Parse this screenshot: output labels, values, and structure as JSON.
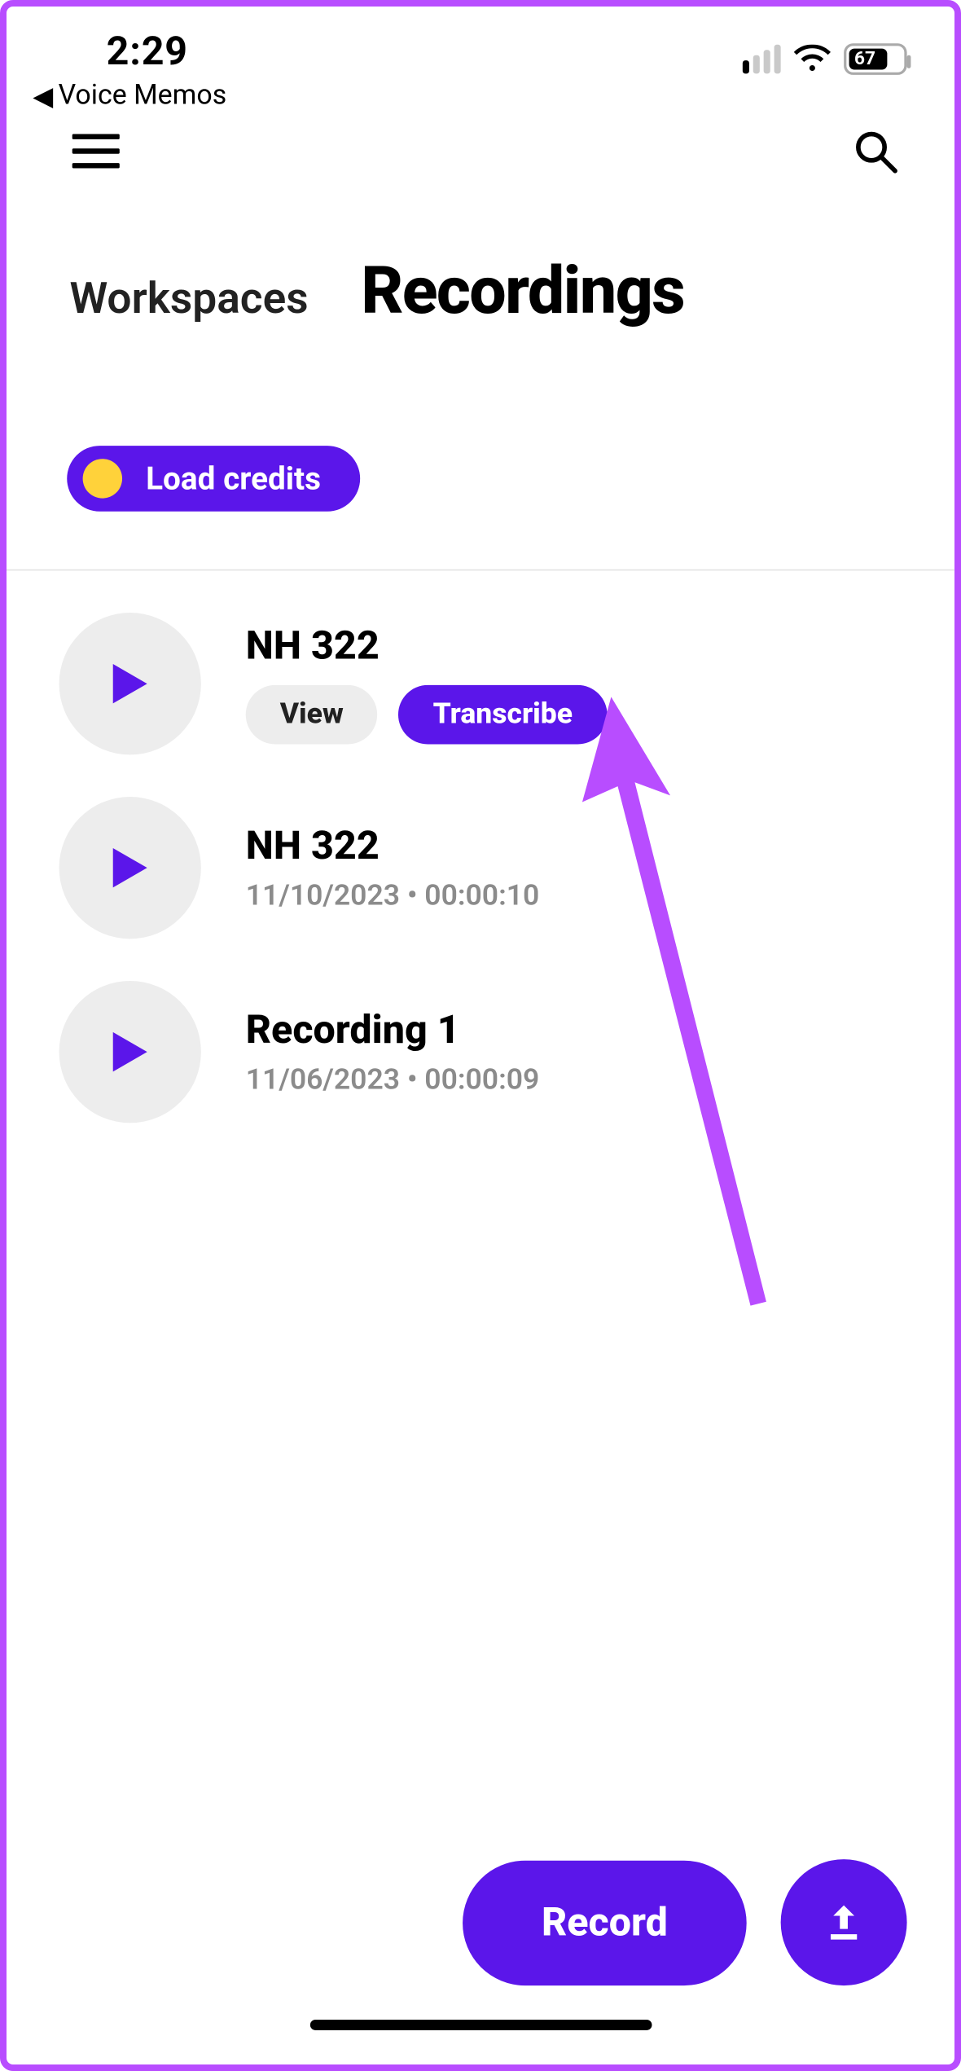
{
  "status_bar": {
    "time": "2:29",
    "battery_percent": "67"
  },
  "back_strip": {
    "label": "Voice Memos"
  },
  "header": {
    "breadcrumb": "Workspaces",
    "title": "Recordings"
  },
  "credits": {
    "label": "Load credits"
  },
  "recordings": [
    {
      "title": "NH 322",
      "actions": {
        "view": "View",
        "transcribe": "Transcribe"
      }
    },
    {
      "title": "NH 322",
      "meta": "11/10/2023 • 00:00:10"
    },
    {
      "title": "Recording 1",
      "meta": "11/06/2023 • 00:00:09"
    }
  ],
  "bottom": {
    "record_label": "Record"
  },
  "colors": {
    "accent": "#5b16ea",
    "annotation": "#b84dff",
    "coin": "#ffd23a"
  }
}
